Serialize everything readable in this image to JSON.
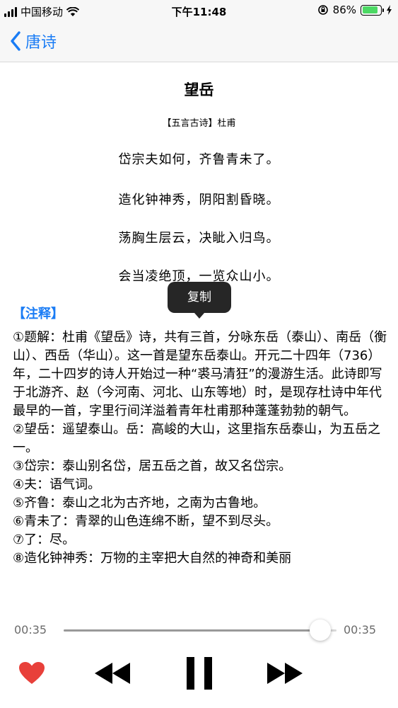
{
  "status_bar": {
    "carrier": "中国移动",
    "time": "下午11:48",
    "battery": "86%",
    "battery_level": 0.86
  },
  "nav": {
    "back_label": "唐诗"
  },
  "poem": {
    "title": "望岳",
    "meta": "【五言古诗】杜甫",
    "lines": [
      "岱宗夫如何，齐鲁青未了。",
      "造化钟神秀，阴阳割昏晓。",
      "荡胸生层云，决眦入归鸟。",
      "会当凌绝顶，一览众山小。"
    ]
  },
  "context_menu": {
    "copy_label": "复制"
  },
  "notes": {
    "title": "【注释】",
    "items": [
      "①题解：杜甫《望岳》诗，共有三首，分咏东岳（泰山）、南岳（衡山）、西岳（华山）。这一首是望东岳泰山。开元二十四年（736）年，二十四岁的诗人开始过一种“裘马清狂”的漫游生活。此诗即写于北游齐、赵（今河南、河北、山东等地）时，是现存杜诗中年代最早的一首，字里行间洋溢着青年杜甫那种蓬蓬勃勃的朝气。",
      "②望岳：遥望泰山。岳：高峻的大山，这里指东岳泰山，为五岳之一。",
      "③岱宗：泰山别名岱，居五岳之首，故又名岱宗。",
      "④夫：语气词。",
      "⑤齐鲁：泰山之北为古齐地，之南为古鲁地。",
      "⑥青未了：青翠的山色连绵不断，望不到尽头。",
      "⑦了：尽。",
      "⑧造化钟神秀：万物的主宰把大自然的神奇和美丽"
    ]
  },
  "player": {
    "current_time": "00:35",
    "total_time": "00:35",
    "progress": 0.94,
    "accent_color": "#e8403a"
  }
}
